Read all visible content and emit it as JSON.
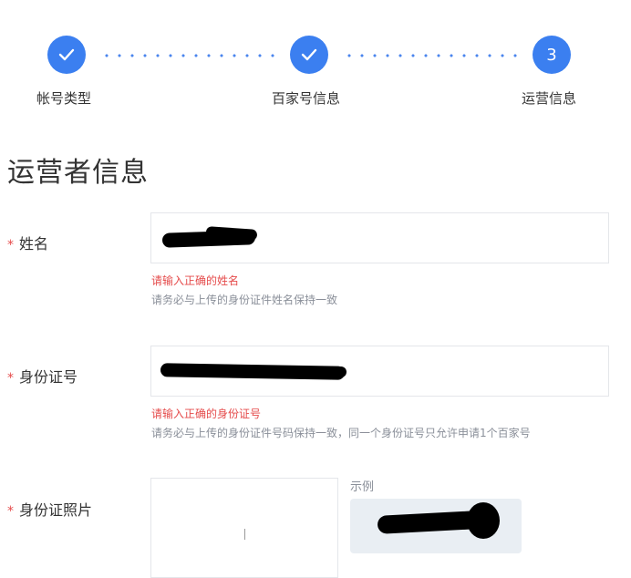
{
  "steps": [
    {
      "label": "帐号类型",
      "status": "done",
      "icon": "check-icon"
    },
    {
      "label": "百家号信息",
      "status": "done",
      "icon": "check-icon"
    },
    {
      "label": "运营信息",
      "status": "current",
      "number": "3"
    }
  ],
  "section_title": "运营者信息",
  "fields": {
    "name": {
      "required_mark": "*",
      "label": "姓名",
      "error": "请输入正确的姓名",
      "hint": "请务必与上传的身份证件姓名保持一致"
    },
    "id_number": {
      "required_mark": "*",
      "label": "身份证号",
      "error": "请输入正确的身份证号",
      "hint": "请务必与上传的身份证件号码保持一致，同一个身份证号只允许申请1个百家号"
    },
    "id_photo": {
      "required_mark": "*",
      "label": "身份证照片",
      "example_label": "示例"
    }
  },
  "colors": {
    "accent": "#3b7ff0",
    "error": "#e54b4b",
    "hint": "#8a8f99"
  }
}
